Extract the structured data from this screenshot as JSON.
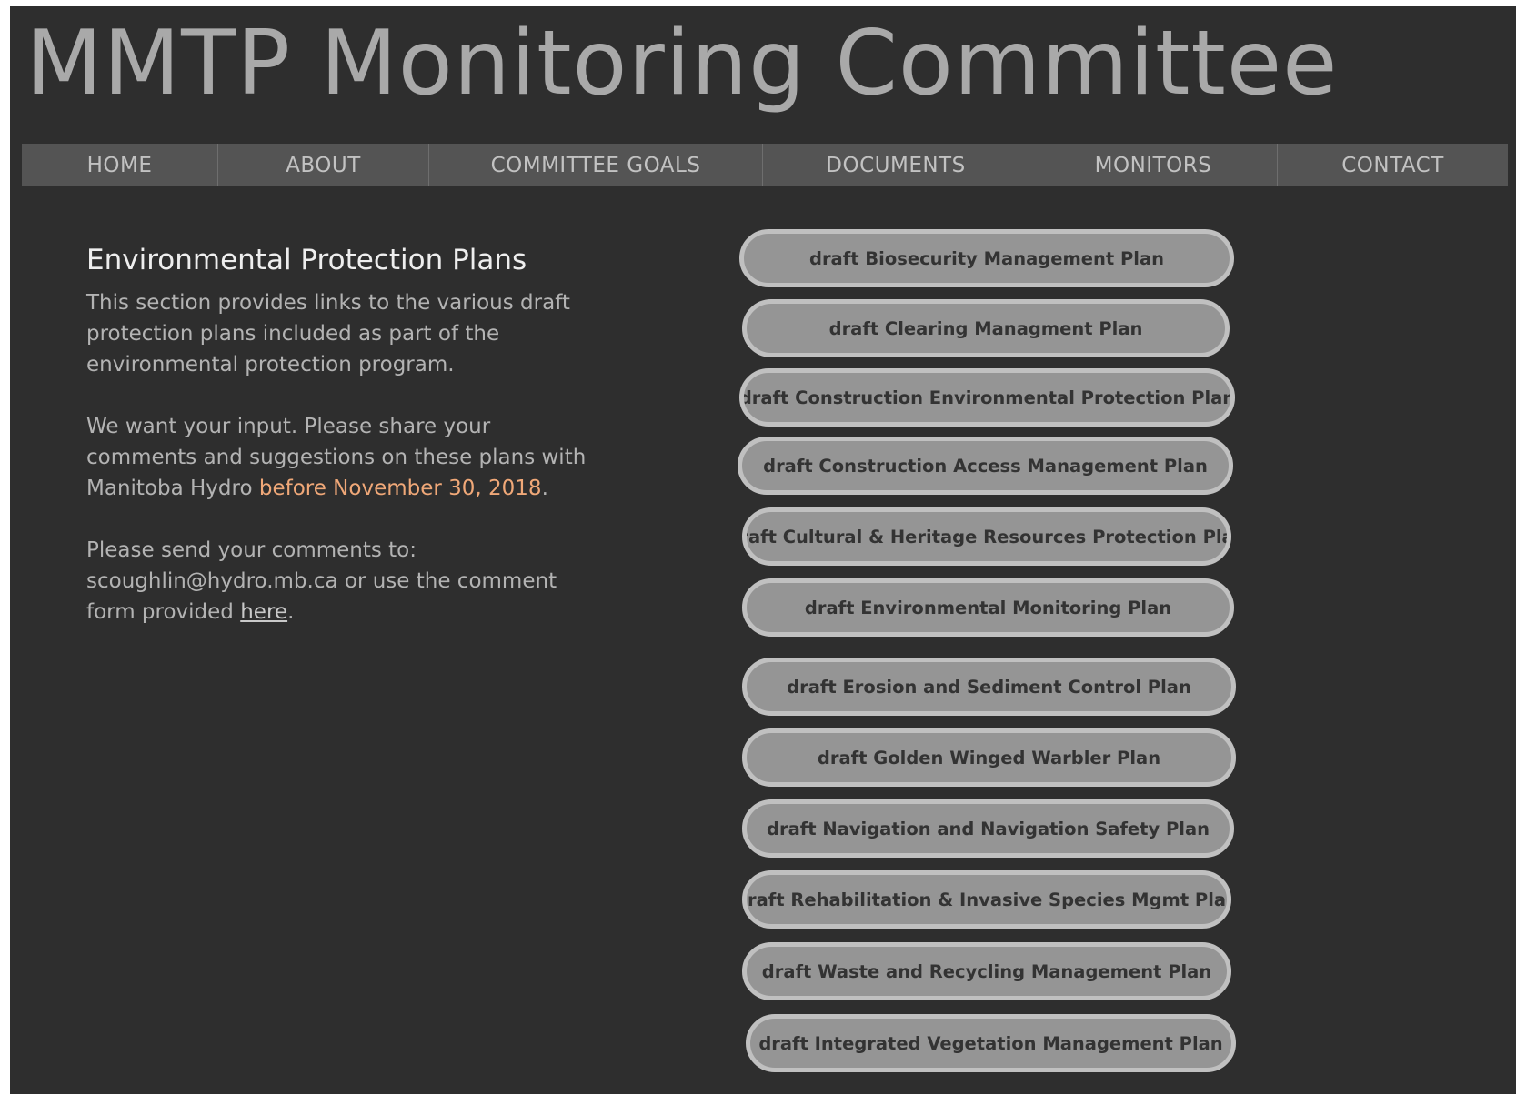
{
  "site": {
    "title": "MMTP Monitoring Committee"
  },
  "nav": {
    "items": [
      {
        "label": "HOME"
      },
      {
        "label": "ABOUT"
      },
      {
        "label": "COMMITTEE GOALS"
      },
      {
        "label": "DOCUMENTS"
      },
      {
        "label": "MONITORS"
      },
      {
        "label": "CONTACT"
      }
    ]
  },
  "section": {
    "heading": "Environmental Protection Plans",
    "para1": "This section provides links to the various draft  protection plans included as part of the environmental protection program.",
    "para2_text": "We want your input.  Please share your comments and suggestions on these plans with Manitoba Hydro ",
    "para2_highlight": "before November 30, 2018",
    "para2_end": ".",
    "para3_text": "Please send your comments to: scoughlin@hydro.mb.ca or use the comment form provided ",
    "para3_link": "here",
    "para3_end": "."
  },
  "plans": [
    {
      "label": "draft Biosecurity Management Plan"
    },
    {
      "label": "draft Clearing Managment Plan"
    },
    {
      "label": "draft Construction Environmental Protection Plan"
    },
    {
      "label": "draft Construction Access Management Plan"
    },
    {
      "label": "draft Cultural & Heritage Resources Protection Plan"
    },
    {
      "label": "draft Environmental Monitoring Plan"
    },
    {
      "label": "draft Erosion and Sediment Control Plan"
    },
    {
      "label": "draft Golden Winged Warbler Plan"
    },
    {
      "label": "draft Navigation and Navigation Safety Plan"
    },
    {
      "label": "draft Rehabilitation & Invasive Species Mgmt Plan"
    },
    {
      "label": "draft Waste and Recycling Management Plan"
    },
    {
      "label": "draft Integrated Vegetation Management Plan"
    }
  ],
  "colors": {
    "page_background": "#2e2e2e",
    "nav_background": "#545454",
    "button_fill": "#959595",
    "button_border": "#c0c0c0",
    "highlight": "#f0a878"
  }
}
